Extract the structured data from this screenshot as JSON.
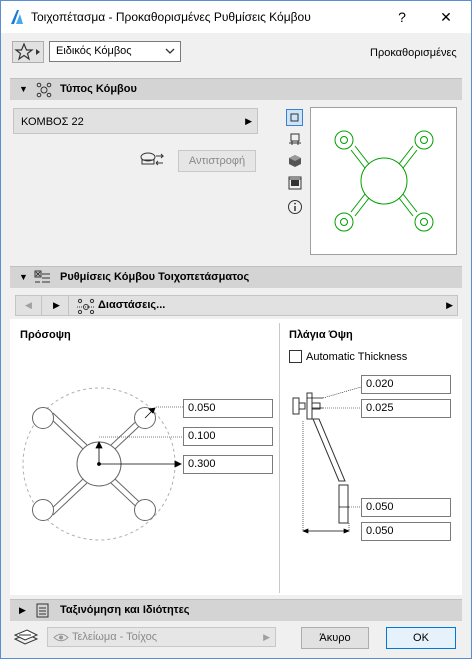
{
  "window": {
    "title": "Τοιχοπέτασμα - Προκαθορισμένες Ρυθμίσεις Κόμβου",
    "help": "?",
    "close": "✕"
  },
  "top": {
    "dropdown_value": "Ειδικός Κόμβος",
    "right_label": "Προκαθορισμένες"
  },
  "section_node_type": {
    "title": "Τύπος Κόμβου",
    "selector_value": "ΚΟΜΒΟΣ 22",
    "reverse_button": "Αντιστροφή"
  },
  "section_node_settings": {
    "title": "Ρυθμίσεις Κόμβου Τοιχοπετάσματος",
    "page_label": "Διαστάσεις..."
  },
  "front_view": {
    "title": "Πρόσοψη",
    "values": [
      "0.050",
      "0.100",
      "0.300"
    ]
  },
  "side_view": {
    "title": "Πλάγια Όψη",
    "checkbox_label": "Automatic Thickness",
    "values": [
      "0.020",
      "0.025",
      "0.050",
      "0.050"
    ]
  },
  "section_classification": {
    "title": "Ταξινόμηση και Ιδιότητες"
  },
  "bottom": {
    "layer_value": "Τελείωμα - Τοίχος",
    "cancel": "Άκυρο",
    "ok": "OK"
  },
  "colors": {
    "accent": "#0078d7",
    "preview_green": "#00a000"
  }
}
